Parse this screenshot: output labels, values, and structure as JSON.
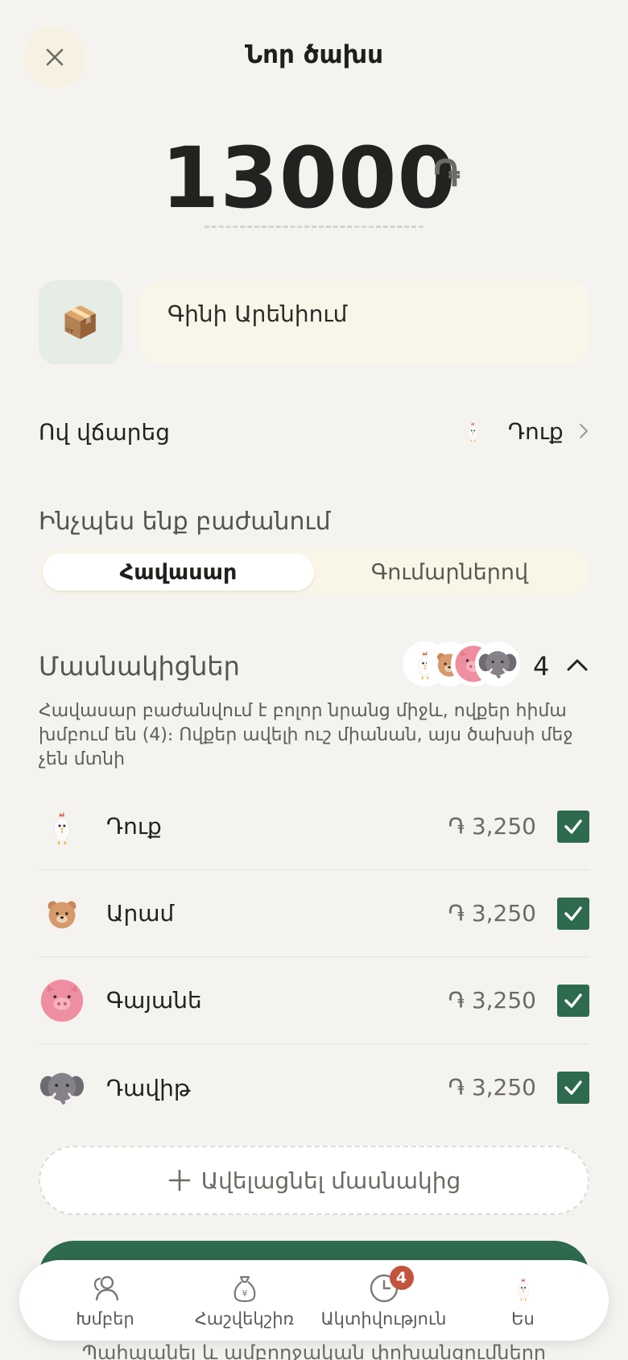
{
  "header": {
    "title": "Նոր ծախս",
    "close_icon": "close-icon"
  },
  "amount": {
    "value": "13000",
    "currency_symbol": "֏"
  },
  "description": {
    "category_icon": "package-icon",
    "category_emoji": "📦",
    "value": "Գինի Արենիում"
  },
  "payer": {
    "label": "Ով վճարեց",
    "name": "Դուք",
    "avatar": "chicken-avatar"
  },
  "split": {
    "heading": "Ինչպես ենք բաժանում",
    "options": [
      "Հավասար",
      "Գումարներով"
    ],
    "selected": "Հավասար"
  },
  "participants": {
    "heading": "Մասնակիցներ",
    "count": "4",
    "note": "Հավասար բաժանվում է բոլոր նրանց միջև, ովքեր հիմա խմբում են (4)։ Ովքեր ավելի ուշ միանան, այս ծախսի մեջ չեն մտնի",
    "members": [
      {
        "name": "Դուք",
        "share": "֏ 3,250",
        "checked": true,
        "avatar": "chicken-avatar"
      },
      {
        "name": "Արամ",
        "share": "֏ 3,250",
        "checked": true,
        "avatar": "bear-avatar"
      },
      {
        "name": "Գայանե",
        "share": "֏ 3,250",
        "checked": true,
        "avatar": "pig-avatar"
      },
      {
        "name": "Դավիթ",
        "share": "֏ 3,250",
        "checked": true,
        "avatar": "elephant-avatar"
      }
    ],
    "add_label": "Ավելացնել մասնակից"
  },
  "partially_hidden_text": "Պահպանել և ամբողջական փոխանցումները",
  "tabs": [
    {
      "label": "Խմբեր",
      "icon": "people-icon"
    },
    {
      "label": "Հաշվեկշիռ",
      "icon": "money-bag-icon"
    },
    {
      "label": "Ակտիվություն",
      "icon": "clock-icon",
      "badge": "4"
    },
    {
      "label": "Ես",
      "icon": "chicken-avatar"
    }
  ],
  "colors": {
    "accent": "#2e6a4e",
    "badge": "#c2533d",
    "background": "#f4f3ef"
  }
}
